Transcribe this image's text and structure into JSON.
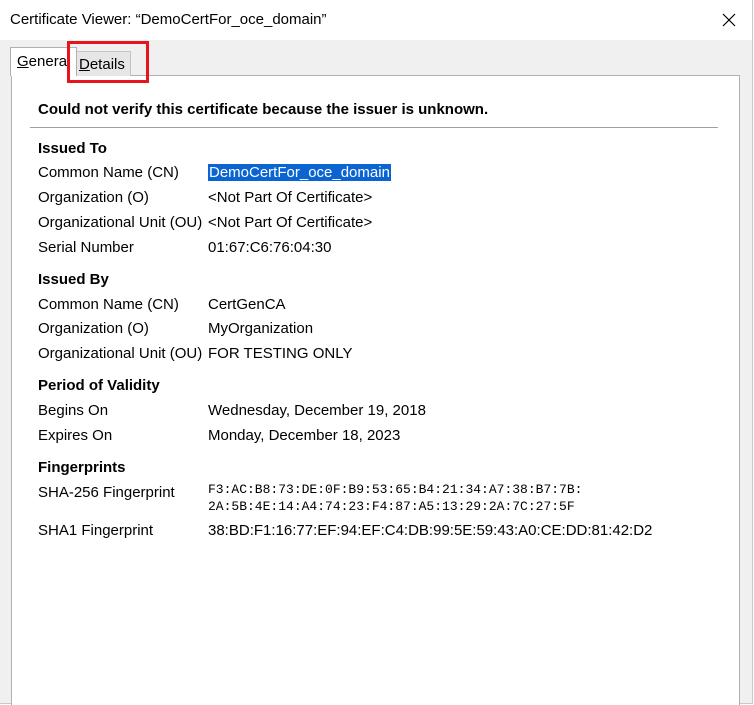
{
  "window": {
    "title": "Certificate Viewer: “DemoCertFor_oce_domain”",
    "close_icon": "close-icon"
  },
  "tabs": [
    {
      "label": "General",
      "selected": true
    },
    {
      "label": "Details",
      "selected": false
    }
  ],
  "warning": "Could not verify this certificate because the issuer is unknown.",
  "issued_to": {
    "heading": "Issued To",
    "rows": [
      {
        "label": "Common Name (CN)",
        "value": "DemoCertFor_oce_domain"
      },
      {
        "label": "Organization (O)",
        "value": "<Not Part Of Certificate>"
      },
      {
        "label": "Organizational Unit (OU)",
        "value": "<Not Part Of Certificate>"
      },
      {
        "label": "Serial Number",
        "value": "01:67:C6:76:04:30"
      }
    ]
  },
  "issued_by": {
    "heading": "Issued By",
    "rows": [
      {
        "label": "Common Name (CN)",
        "value": "CertGenCA"
      },
      {
        "label": "Organization (O)",
        "value": "MyOrganization"
      },
      {
        "label": "Organizational Unit (OU)",
        "value": "FOR TESTING ONLY"
      }
    ]
  },
  "validity": {
    "heading": "Period of Validity",
    "rows": [
      {
        "label": "Begins On",
        "value": "Wednesday, December 19, 2018"
      },
      {
        "label": "Expires On",
        "value": "Monday, December 18, 2023"
      }
    ]
  },
  "fingerprints": {
    "heading": "Fingerprints",
    "sha256_label": "SHA-256 Fingerprint",
    "sha256_line1": "F3:AC:B8:73:DE:0F:B9:53:65:B4:21:34:A7:38:B7:7B:",
    "sha256_line2": "2A:5B:4E:14:A4:74:23:F4:87:A5:13:29:2A:7C:27:5F",
    "sha1_label": "SHA1 Fingerprint",
    "sha1_value": "38:BD:F1:16:77:EF:94:EF:C4:DB:99:5E:59:43:A0:CE:DD:81:42:D2"
  },
  "colors": {
    "highlight_box": "#e8141c",
    "selection": "#0a64d2"
  }
}
